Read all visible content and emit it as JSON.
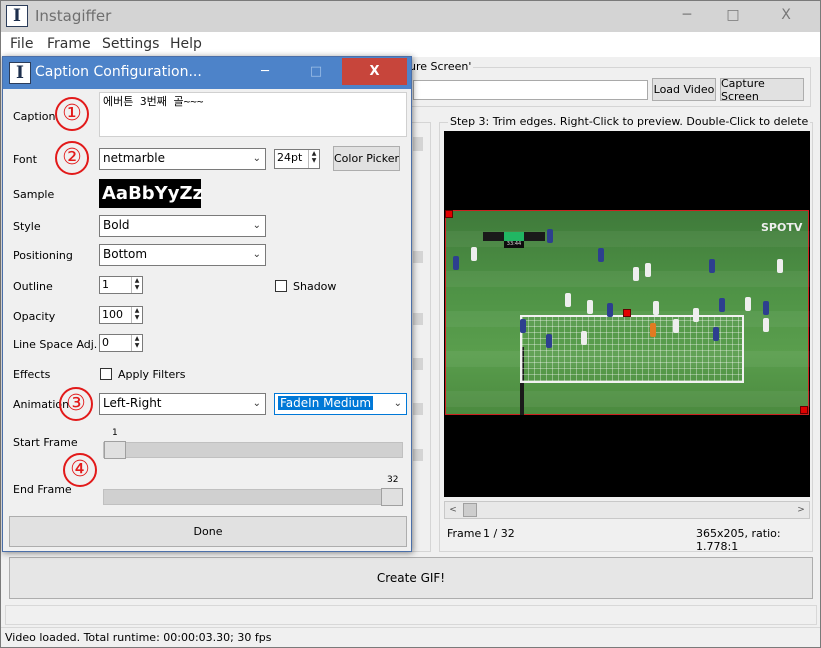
{
  "app": {
    "icon_letter": "I",
    "title": "Instagiffer",
    "minimize_glyph": "─",
    "maximize_glyph": "□",
    "close_glyph": "X"
  },
  "menu": [
    "File",
    "Frame",
    "Settings",
    "Help"
  ],
  "step1": {
    "label_fragment": "ure Screen'",
    "load_video_label": "Load Video",
    "capture_screen_label": "Capture Screen"
  },
  "step3": {
    "label": "Step 3: Trim edges. Right-Click to preview. Double-Click to delete",
    "spotv_logo": "SPOTV",
    "clock": "33:44",
    "frame_label": "Frame",
    "frame_value": "1 / 32",
    "dimensions": "365x205, ratio: 1.778:1",
    "scroll_left": "<",
    "scroll_right": ">"
  },
  "create_gif_label": "Create GIF!",
  "status_text": "Video loaded. Total runtime: 00:00:03.30; 30 fps",
  "dialog": {
    "icon_letter": "I",
    "title": "Caption Configuration...",
    "minimize_glyph": "─",
    "maximize_glyph": "□",
    "close_glyph": "X",
    "caption_label": "Caption",
    "caption_value": "에버튼 3번째 골~~~",
    "font_label": "Font",
    "font_value": "netmarble",
    "font_size": "24pt",
    "color_picker_label": "Color Picker",
    "sample_label": "Sample",
    "sample_text": "AaBbYyZz",
    "style_label": "Style",
    "style_value": "Bold",
    "positioning_label": "Positioning",
    "positioning_value": "Bottom",
    "outline_label": "Outline",
    "outline_value": "1",
    "shadow_label": "Shadow",
    "opacity_label": "Opacity",
    "opacity_value": "100",
    "line_space_label": "Line Space Adj.",
    "line_space_value": "0",
    "effects_label": "Effects",
    "apply_filters_label": "Apply Filters",
    "animation_label": "Animation",
    "animation_value": "Left-Right",
    "animation_speed_value": "FadeIn Medium",
    "start_frame_label": "Start Frame",
    "start_frame_value": "1",
    "end_frame_label": "End Frame",
    "end_frame_value": "32",
    "done_label": "Done"
  },
  "annotations": [
    "①",
    "②",
    "③",
    "④"
  ],
  "colors": {
    "dialog_titlebar": "#4d83c9",
    "close_button": "#c7453b",
    "annotation_red": "#e21a1a",
    "selection_blue": "#0078d7"
  }
}
